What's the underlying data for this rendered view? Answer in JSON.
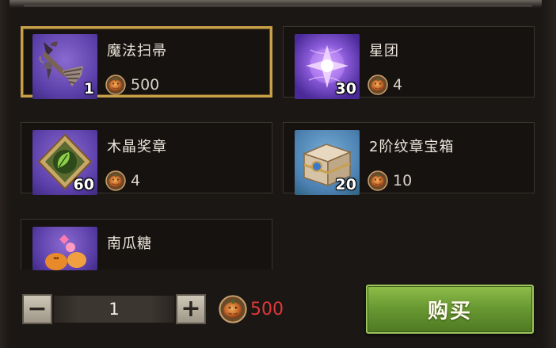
{
  "items": [
    {
      "name": "魔法扫帚",
      "qty": "1",
      "price": "500",
      "icon": "broom-icon"
    },
    {
      "name": "星团",
      "qty": "30",
      "price": "4",
      "icon": "star-cluster-icon"
    },
    {
      "name": "木晶奖章",
      "qty": "60",
      "price": "4",
      "icon": "wood-crystal-medal-icon"
    },
    {
      "name": "2阶纹章宝箱",
      "qty": "20",
      "price": "10",
      "icon": "crest-chest-icon"
    },
    {
      "name": "南瓜糖",
      "qty": "",
      "price": "",
      "icon": "pumpkin-candy-icon"
    }
  ],
  "quantity": {
    "minus": "−",
    "value": "1",
    "plus": "+"
  },
  "total_price": "500",
  "buy_label": "购买",
  "colors": {
    "selected_border": "#c8a04a",
    "buy_button": "#6a9a33",
    "total_price": "#e0383a"
  }
}
